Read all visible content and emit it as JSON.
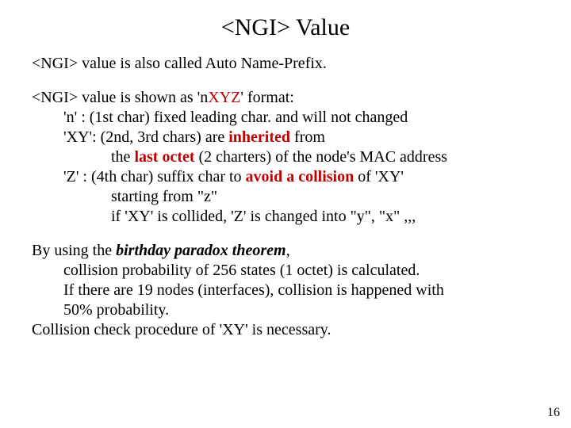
{
  "slide": {
    "title": "<NGI> Value",
    "p1": "<NGI> value is also called Auto Name-Prefix.",
    "format": {
      "lead": "<NGI> value is shown as 'n",
      "xy": "XY",
      "z": "Z",
      "tail": "' format:",
      "n": "'n' : (1st char) fixed leading char. and will not changed",
      "xy_line": {
        "pre": "'XY': (2nd, 3rd chars) are ",
        "inh": "inherited",
        "post": " from"
      },
      "xy_sub": {
        "pre": "the ",
        "lastoctet": "last octet",
        "post": " (2 charters) of the node's MAC address"
      },
      "z_line": {
        "pre": "'Z' : (4th char) suffix char to ",
        "avoid": "avoid a collision",
        "post": " of 'XY'"
      },
      "z_sub1": "starting from \"z\"",
      "z_sub2": "if 'XY' is collided, 'Z' is changed into \"y\", \"x\" ,,,"
    },
    "birthday": {
      "l1a": "By using the ",
      "l1b": "birthday paradox theorem",
      "l1c": ",",
      "l2": "collision probability of 256 states (1 octet) is calculated.",
      "l3": "If there are 19 nodes (interfaces), collision is happened with",
      "l4": "50% probability.",
      "l5": "Collision check procedure of 'XY' is necessary."
    },
    "page": "16"
  }
}
